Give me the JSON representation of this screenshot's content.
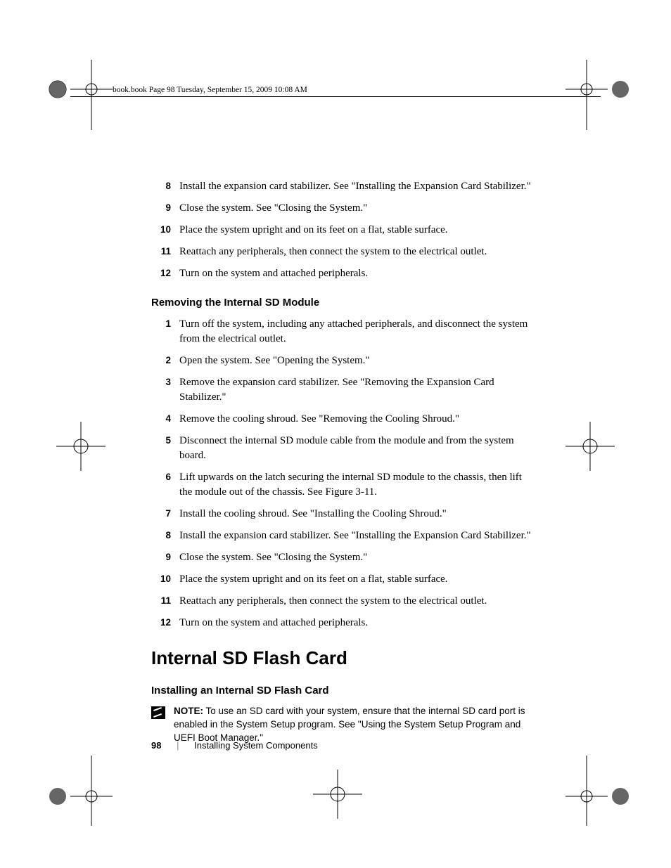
{
  "header": "book.book  Page 98  Tuesday, September 15, 2009  10:08 AM",
  "list1": [
    {
      "n": "8",
      "t": "Install the expansion card stabilizer. See \"Installing the Expansion Card Stabilizer.\""
    },
    {
      "n": "9",
      "t": "Close the system. See \"Closing the System.\""
    },
    {
      "n": "10",
      "t": "Place the system upright and on its feet on a flat, stable surface."
    },
    {
      "n": "11",
      "t": "Reattach any peripherals, then connect the system to the electrical outlet."
    },
    {
      "n": "12",
      "t": "Turn on the system and attached peripherals."
    }
  ],
  "sub1": "Removing the Internal SD Module",
  "list2": [
    {
      "n": "1",
      "t": "Turn off the system, including any attached peripherals, and disconnect the system from the electrical outlet."
    },
    {
      "n": "2",
      "t": "Open the system. See \"Opening the System.\""
    },
    {
      "n": "3",
      "t": "Remove the expansion card stabilizer. See \"Removing the Expansion Card Stabilizer.\""
    },
    {
      "n": "4",
      "t": "Remove the cooling shroud. See \"Removing the Cooling Shroud.\""
    },
    {
      "n": "5",
      "t": "Disconnect the internal SD module cable from the module and from the system board."
    },
    {
      "n": "6",
      "t": "Lift upwards on the latch securing the internal SD module to the chassis, then lift the module out of the chassis. See Figure 3-11."
    },
    {
      "n": "7",
      "t": "Install the cooling shroud. See \"Installing the Cooling Shroud.\""
    },
    {
      "n": "8",
      "t": "Install the expansion card stabilizer. See \"Installing the Expansion Card Stabilizer.\""
    },
    {
      "n": "9",
      "t": "Close the system. See \"Closing the System.\""
    },
    {
      "n": "10",
      "t": "Place the system upright and on its feet on a flat, stable surface."
    },
    {
      "n": "11",
      "t": "Reattach any peripherals, then connect the system to the electrical outlet."
    },
    {
      "n": "12",
      "t": "Turn on the system and attached peripherals."
    }
  ],
  "head1": "Internal SD Flash Card",
  "sub2": "Installing an Internal SD Flash Card",
  "note": {
    "label": "NOTE:",
    "text": " To use an SD card with your system, ensure that the internal SD card port is enabled in the System Setup program. See \"Using the System Setup Program and UEFI Boot Manager.\""
  },
  "footer": {
    "page": "98",
    "section": "Installing System Components"
  }
}
